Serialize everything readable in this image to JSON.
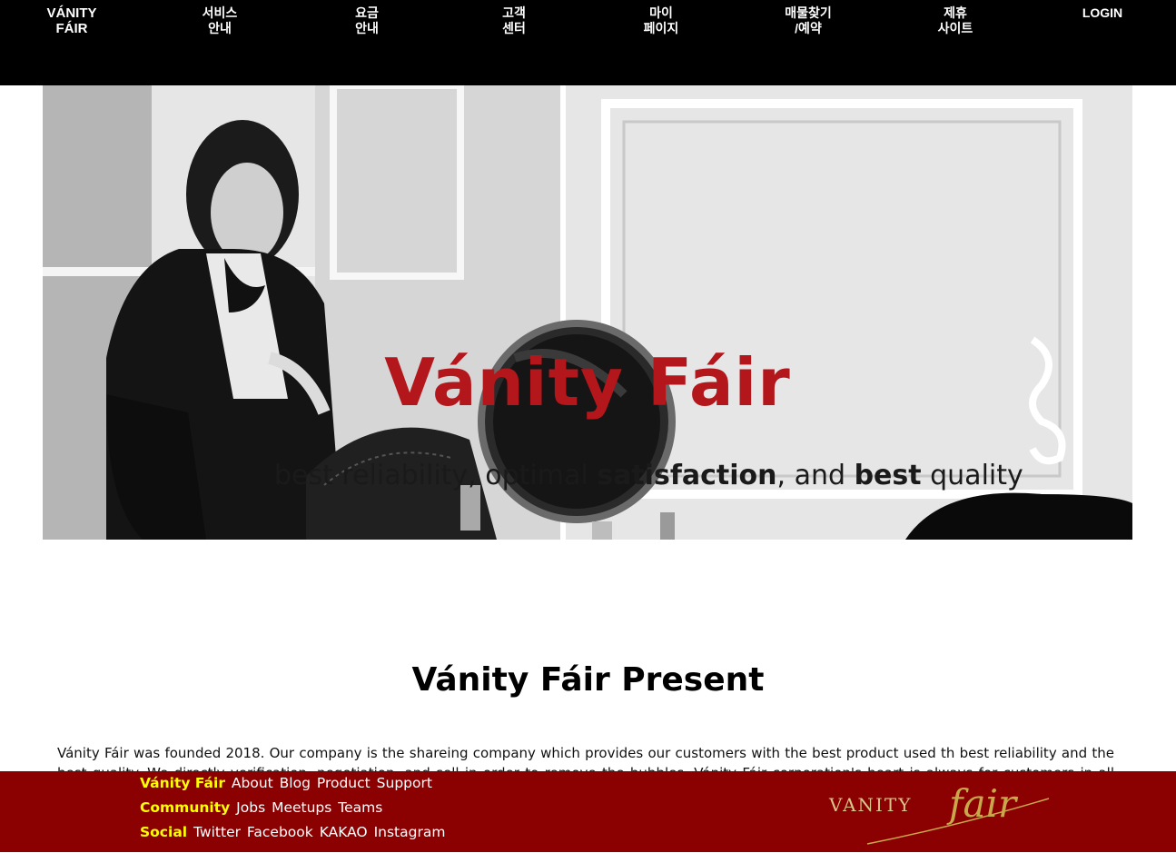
{
  "nav": {
    "brand": "VÁNITY\nFÁIR",
    "items": [
      {
        "label": "서비스\n안내"
      },
      {
        "label": "요금\n안내"
      },
      {
        "label": "고객\n센터"
      },
      {
        "label": "마이\n페이지"
      },
      {
        "label": "매물찾기\n/예약"
      },
      {
        "label": "제휴\n사이트"
      }
    ],
    "login": "LOGIN"
  },
  "hero": {
    "title": "Vánity Fáir",
    "tagline_prefix": "best reliability, optimal ",
    "tagline_bold1": "satisfaction",
    "tagline_mid": ", and ",
    "tagline_bold2": "best",
    "tagline_suffix": " quality"
  },
  "present": {
    "title": "Vánity Fáir Present",
    "body": "Vánity Fáir was founded 2018. Our company is the shareing company which provides our customers with the best product used th best reliability and the best quality. We directly verification, negotiation, and sell in order to remove the bubbles. Vánity Fáir corporation's heart is always for customers in all ages. We"
  },
  "footer": {
    "rows": [
      {
        "head": "Vánity Fáir",
        "links": [
          "About",
          "Blog",
          "Product",
          "Support"
        ]
      },
      {
        "head": "Community",
        "links": [
          "Jobs",
          "Meetups",
          "Teams"
        ]
      },
      {
        "head": "Social",
        "links": [
          "Twitter",
          "Facebook",
          "KAKAO",
          "Instagram"
        ]
      }
    ],
    "logo_text_a": "VANITY",
    "logo_text_b": "fair"
  },
  "colors": {
    "nav_bg": "#000000",
    "accent_red": "#b3161b",
    "footer_bg": "#8b0000",
    "footer_heading": "#ffff00",
    "logo_gold": "#c9a84c"
  }
}
